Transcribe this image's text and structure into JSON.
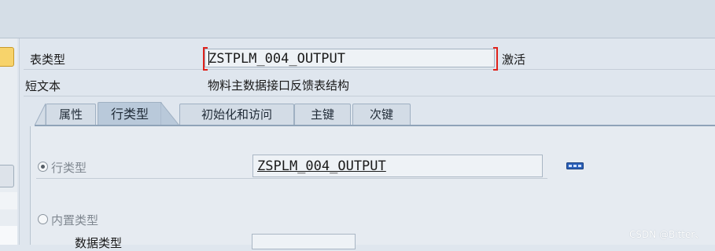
{
  "header": {
    "table_type_label": "表类型",
    "table_type_value": "ZSTPLM_004_OUTPUT",
    "status": "激活",
    "short_text_label": "短文本",
    "short_text_value": "物料主数据接口反馈表结构"
  },
  "tabs": [
    {
      "label": "属性",
      "active": false
    },
    {
      "label": "行类型",
      "active": true
    },
    {
      "label": "初始化和访问",
      "active": false
    },
    {
      "label": "主键",
      "active": false
    },
    {
      "label": "次键",
      "active": false
    }
  ],
  "row_type": {
    "radio_label": "行类型",
    "selected": true,
    "value": "ZSPLM_004_OUTPUT",
    "details_icon": "details-icon"
  },
  "builtin_type": {
    "radio_label": "内置类型",
    "selected": false,
    "data_type_label": "数据类型"
  },
  "watermark": "CSDN @Bitter、",
  "colors": {
    "highlight_bracket": "#e0221b",
    "active_tab": "#b9c9da",
    "background": "#e6ebf1"
  }
}
